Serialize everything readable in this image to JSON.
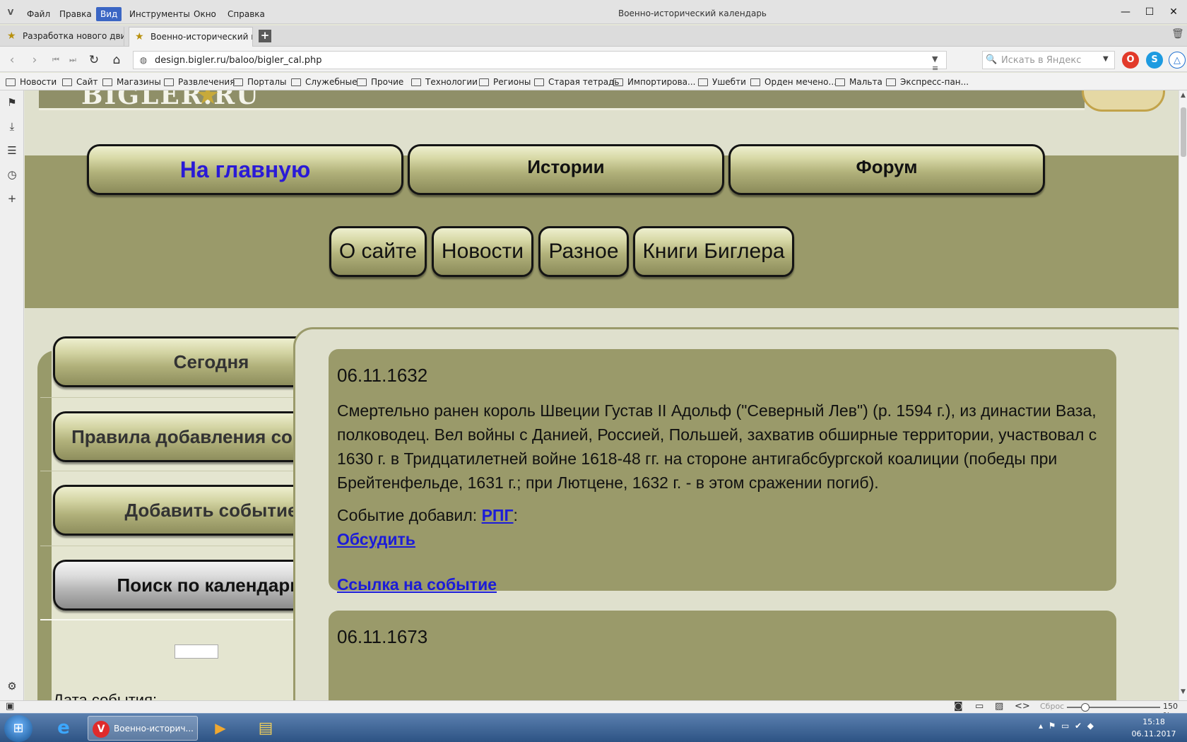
{
  "window": {
    "app_icon": "vivaldi-icon",
    "menu": [
      "Файл",
      "Правка",
      "Вид",
      "Инструменты",
      "Окно",
      "Справка"
    ],
    "active_menu": "Вид",
    "title": "Военно-исторический календарь",
    "controls": [
      "—",
      "☐",
      "✕"
    ]
  },
  "tabs": [
    {
      "label": "Разработка нового движка",
      "icon": "star-icon",
      "active": false
    },
    {
      "label": "Военно-исторический кале",
      "icon": "star-icon",
      "active": true
    }
  ],
  "address": {
    "url": "design.bigler.ru/baloo/bigler_cal.php",
    "search_placeholder": "Искать в Яндекс"
  },
  "bookmarks": [
    "Новости",
    "Сайт",
    "Магазины",
    "Развлечения",
    "Порталы",
    "Служебные",
    "Прочие",
    "Технологии",
    "Регионы",
    "Старая тетрадь",
    "Импортирова...",
    "Ушебти",
    "Орден мечено...",
    "Мальта",
    "Экспресс-пан..."
  ],
  "site": {
    "banner_text": "BIGLER.RU",
    "nav_main": [
      "На главную",
      "Истории",
      "Форум"
    ],
    "nav_main_colors": [
      "#2a1ad6",
      "#111111",
      "#111111"
    ],
    "nav_sub": [
      "О сайте",
      "Новости",
      "Разное",
      "Книги Биглера"
    ],
    "sidebar": {
      "buttons": [
        "Сегодня",
        "Правила добавления событий",
        "Добавить событие",
        "Поиск по календарю"
      ],
      "search_label": "Дата события:"
    },
    "events": [
      {
        "date": "06.11.1632",
        "text": "Смертельно ранен король Швеции Густав II Адольф (\"Северный Лев\") (р. 1594 г.), из династии Ваза, полководец. Вел войны с Данией, Россией, Польшей, захватив обширные территории, участвовал с 1630 г. в Тридцатилетней войне 1618-48 гг. на стороне антигабсбургской коалиции (победы при Брейтенфельде, 1631 г.; при Лютцене, 1632 г. - в этом сражении погиб).",
        "added_by_label": "Событие добавил:",
        "author": "РПГ",
        "author_suffix": ":",
        "discuss": "Обсудить",
        "link": "Ссылка на событие"
      },
      {
        "date": "06.11.1673"
      }
    ]
  },
  "statusbar": {
    "reset_label": "Сброс",
    "zoom": "150 %",
    "zoom_level_fraction": 0.2
  },
  "taskbar": {
    "active_window": "Военно-историч...",
    "time": "15:18",
    "date": "06.11.2017"
  }
}
